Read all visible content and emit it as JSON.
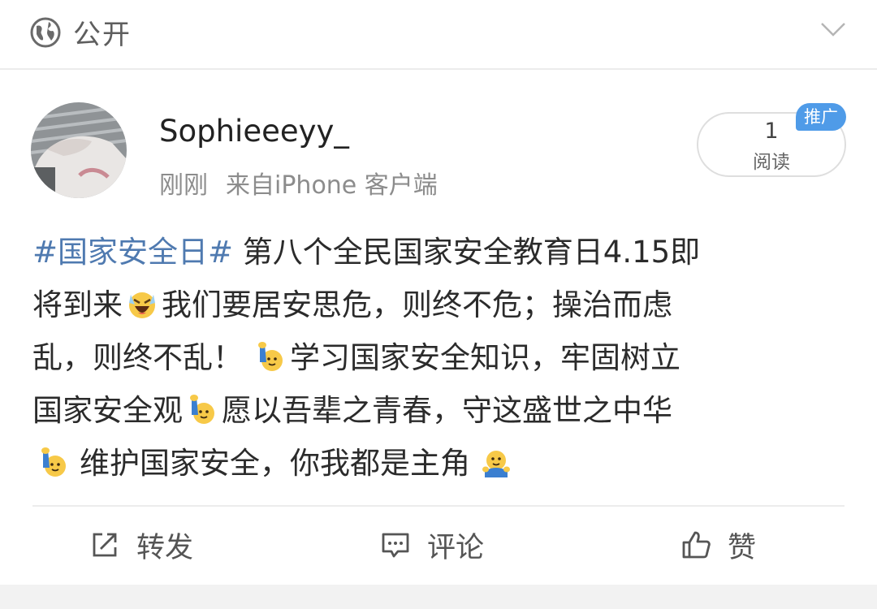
{
  "topbar": {
    "visibility_label": "公开",
    "globe_icon": "globe-icon",
    "expand_icon": "chevron-down-icon"
  },
  "post_header": {
    "username": "Sophieeeyy_",
    "time": "刚刚",
    "source": "来自iPhone 客户端",
    "read_count": "1",
    "read_label": "阅读",
    "promo_label": "推广"
  },
  "post_body": {
    "hashtag": "#国家安全日#",
    "line1_text": " 第八个全民国家安全教育日4.15即",
    "line2_a": "将到来",
    "line2_b": "我们要居安思危，则终不危；操治而虑",
    "line3_a": "乱，则终不乱！",
    "line3_b": "学习国家安全知识，牢固树立",
    "line4_a": "国家安全观",
    "line4_b": "愿以吾辈之青春，守这盛世之中华",
    "line5_a": "维护国家安全，你我都是主角",
    "emojis": [
      "laughing-crying-emoji",
      "raising-hand-emoji",
      "raising-hand-emoji",
      "raising-hand-emoji",
      "hug-emoji"
    ]
  },
  "actions": {
    "repost": "转发",
    "comment": "评论",
    "like": "赞"
  },
  "colors": {
    "hashtag": "#4f7ab0",
    "promo_badge": "#4f9be8",
    "emoji_yellow": "#f7c948"
  }
}
